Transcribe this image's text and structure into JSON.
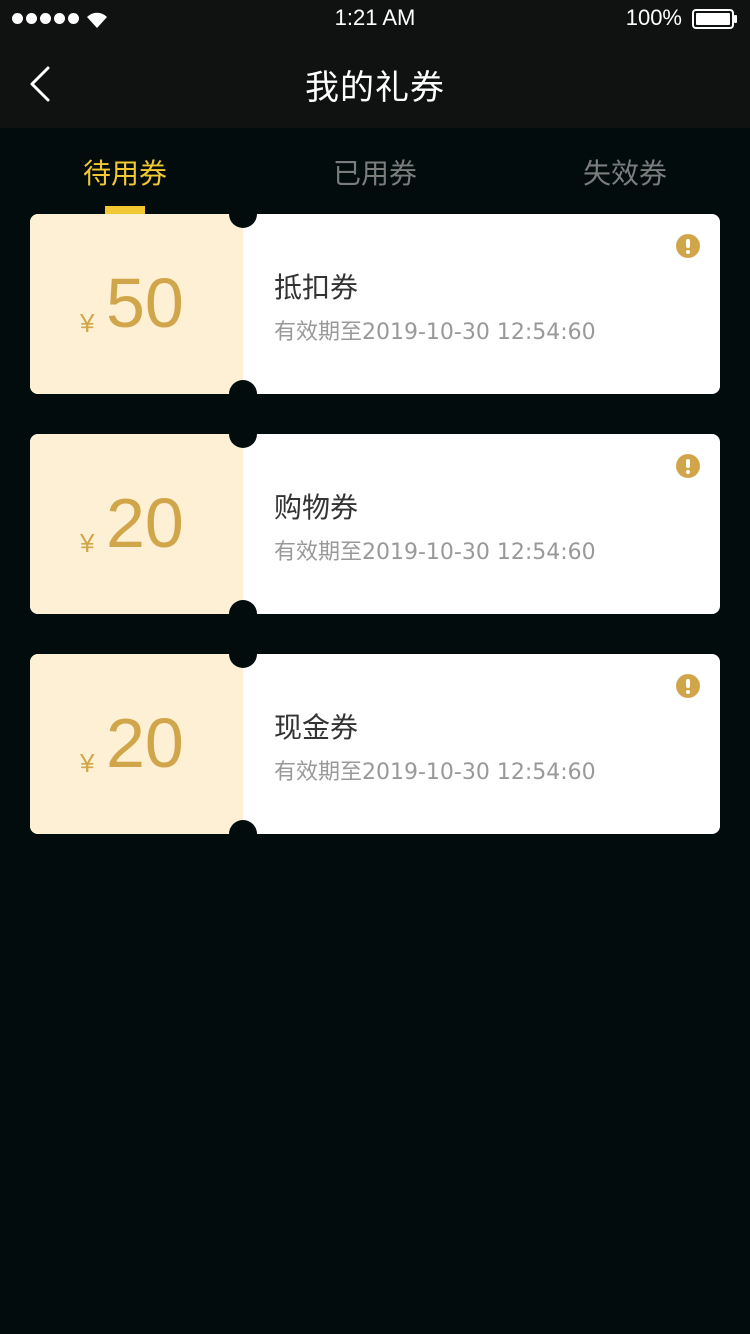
{
  "status_bar": {
    "time": "1:21 AM",
    "battery_percent": "100%"
  },
  "nav": {
    "title": "我的礼券",
    "back_icon": "chevron-left-icon"
  },
  "tabs": [
    {
      "label": "待用券",
      "active": true
    },
    {
      "label": "已用券",
      "active": false
    },
    {
      "label": "失效券",
      "active": false
    }
  ],
  "coupons": [
    {
      "currency": "¥",
      "amount": "50",
      "name": "抵扣券",
      "validity": "有效期至2019-10-30 12:54:60",
      "icon": "info-icon"
    },
    {
      "currency": "¥",
      "amount": "20",
      "name": "购物券",
      "validity": "有效期至2019-10-30 12:54:60",
      "icon": "info-icon"
    },
    {
      "currency": "¥",
      "amount": "20",
      "name": "现金券",
      "validity": "有效期至2019-10-30 12:54:60",
      "icon": "info-icon"
    }
  ],
  "colors": {
    "accent": "#f2c832",
    "gold": "#d1a64b",
    "coupon_left_bg": "#fdf0d5",
    "page_bg": "#020c0c",
    "nav_bg": "#101212"
  }
}
